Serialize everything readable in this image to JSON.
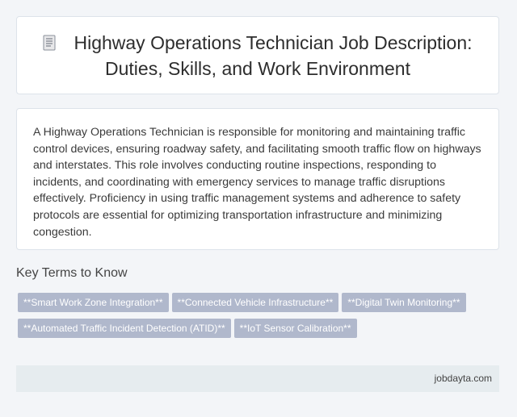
{
  "header": {
    "title": "Highway Operations Technician Job Description: Duties, Skills, and Work Environment",
    "icon": "document-icon"
  },
  "description": {
    "text": "A Highway Operations Technician is responsible for monitoring and maintaining traffic control devices, ensuring roadway safety, and facilitating smooth traffic flow on highways and interstates. This role involves conducting routine inspections, responding to incidents, and coordinating with emergency services to manage traffic disruptions effectively. Proficiency in using traffic management systems and adherence to safety protocols are essential for optimizing transportation infrastructure and minimizing congestion."
  },
  "key_terms": {
    "heading": "Key Terms to Know",
    "tags": [
      "**Smart Work Zone Integration**",
      "**Connected Vehicle Infrastructure**",
      "**Digital Twin Monitoring**",
      "**Automated Traffic Incident Detection (ATID)**",
      "**IoT Sensor Calibration**"
    ]
  },
  "footer": {
    "site": "jobdayta.com"
  },
  "colors": {
    "background": "#f3f5f8",
    "tag_background": "#b0b8cc",
    "footer_background": "#e6ecef"
  }
}
